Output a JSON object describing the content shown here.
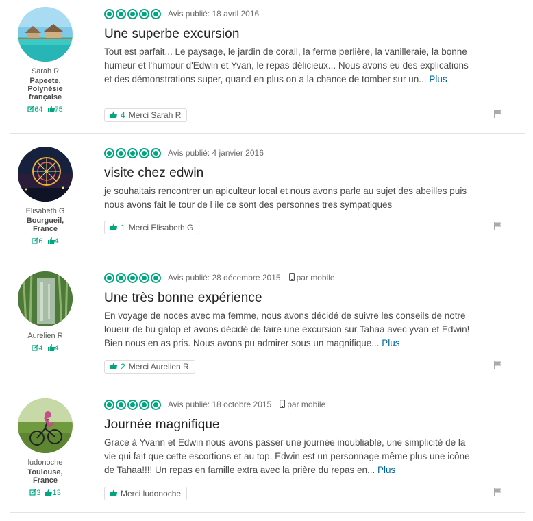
{
  "colors": {
    "accent": "#00a680",
    "link": "#006699"
  },
  "reviews": [
    {
      "member": {
        "name": "Sarah R",
        "location": "Papeete, Polynésie française",
        "reviews": "64",
        "helpful": "75"
      },
      "rating": 5,
      "date": "Avis publié: 18 avril 2016",
      "mobile": "",
      "title": "Une superbe excursion",
      "text": "Tout est parfait... Le paysage, le jardin de corail, la ferme perlière, la vanilleraie, la bonne humeur et l'humour d'Edwin et Yvan, le repas délicieux... Nous avons eu des explications et des démonstrations super, quand en plus on a la chance de tomber sur un...",
      "more": "Plus",
      "thanks_count": "4",
      "thanks_label": "Merci Sarah R"
    },
    {
      "member": {
        "name": "Elisabeth G",
        "location": "Bourgueil, France",
        "reviews": "6",
        "helpful": "4"
      },
      "rating": 5,
      "date": "Avis publié: 4 janvier 2016",
      "mobile": "",
      "title": "visite chez edwin",
      "text": "je souhaitais rencontrer un apiculteur local et nous avons parle au sujet des abeilles puis nous avons fait le tour de l ile ce sont des personnes tres sympatiques",
      "more": "",
      "thanks_count": "1",
      "thanks_label": "Merci Elisabeth G"
    },
    {
      "member": {
        "name": "Aurelien R",
        "location": "",
        "reviews": "4",
        "helpful": "4"
      },
      "rating": 5,
      "date": "Avis publié: 28 décembre 2015",
      "mobile": "par mobile",
      "title": "Une très bonne expérience",
      "text": "En voyage de noces avec ma femme, nous avons décidé de suivre les conseils de notre loueur de bu galop et avons décidé de faire une excursion sur Tahaa avec yvan et Edwin! Bien nous en as pris. Nous avons pu admirer sous un magnifique...",
      "more": "Plus",
      "thanks_count": "2",
      "thanks_label": "Merci Aurelien R"
    },
    {
      "member": {
        "name": "ludonoche",
        "location": "Toulouse, France",
        "reviews": "3",
        "helpful": "13"
      },
      "rating": 5,
      "date": "Avis publié: 18 octobre 2015",
      "mobile": "par mobile",
      "title": "Journée magnifique",
      "text": "Grace à Yvann et Edwin nous avons passer une journée inoubliable, une simplicité de la vie qui fait que cette escortions et au top. Edwin est un personnage même plus une icône de Tahaa!!!! Un repas en famille extra avec la prière du repas en...",
      "more": "Plus",
      "thanks_count": "",
      "thanks_label": "Merci ludonoche"
    }
  ]
}
